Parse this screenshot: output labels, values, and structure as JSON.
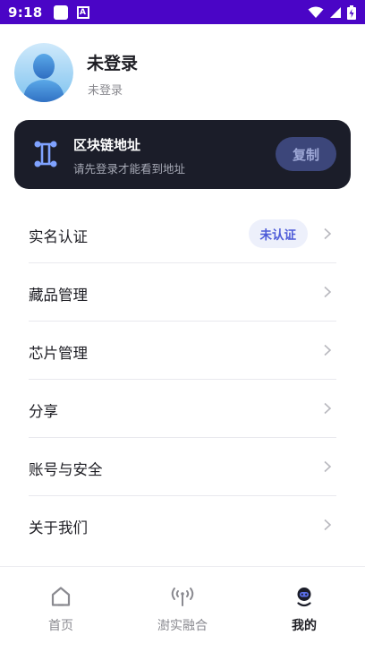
{
  "status_bar": {
    "time": "9:18",
    "a_icon_glyph": "A"
  },
  "profile": {
    "name": "未登录",
    "subtitle": "未登录"
  },
  "chain_card": {
    "title": "区块链地址",
    "subtitle": "请先登录才能看到地址",
    "copy_label": "复制"
  },
  "menu": {
    "items": [
      {
        "label": "实名认证",
        "badge": "未认证"
      },
      {
        "label": "藏品管理"
      },
      {
        "label": "芯片管理"
      },
      {
        "label": "分享"
      },
      {
        "label": "账号与安全"
      },
      {
        "label": "关于我们"
      }
    ]
  },
  "tabs": [
    {
      "label": "首页",
      "icon": "home-icon",
      "active": false
    },
    {
      "label": "澍实融合",
      "icon": "signal-tower-icon",
      "active": false
    },
    {
      "label": "我的",
      "icon": "robot-face-icon",
      "active": true
    }
  ],
  "colors": {
    "status_bar": "#4a05c6",
    "card_bg": "#1b1d29",
    "copy_button": "#3c467a",
    "badge_bg": "#edf0fb",
    "badge_text": "#4d5bd8"
  }
}
